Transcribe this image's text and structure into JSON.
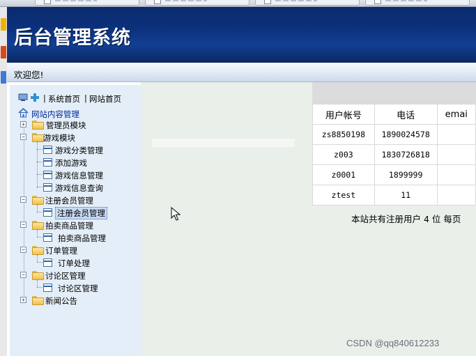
{
  "header": {
    "title": "后台管理系统"
  },
  "welcome": {
    "text": "欢迎您!"
  },
  "sidebar": {
    "top_links": [
      "系统首页",
      "网站首页"
    ],
    "separator": "|",
    "tree_root": "网站内容管理",
    "groups": [
      {
        "label": "管理员模块",
        "expanded": false,
        "children": []
      },
      {
        "label": "游戏模块",
        "expanded": true,
        "children": [
          "游戏分类管理",
          "添加游戏",
          "游戏信息管理",
          "游戏信息查询"
        ]
      },
      {
        "label": "注册会员管理",
        "expanded": true,
        "children": [
          "注册会员管理"
        ]
      },
      {
        "label": "拍卖商品管理",
        "expanded": true,
        "children": [
          "拍卖商品管理"
        ]
      },
      {
        "label": "订单管理",
        "expanded": true,
        "children": [
          "订单处理"
        ]
      },
      {
        "label": "讨论区管理",
        "expanded": true,
        "children": [
          "讨论区管理"
        ]
      },
      {
        "label": "新闻公告",
        "expanded": false,
        "children": []
      }
    ],
    "selected": "注册会员管理"
  },
  "table": {
    "headers": [
      "用户帐号",
      "电话",
      "emai"
    ],
    "rows": [
      [
        "zs8850198",
        "1890024578",
        ""
      ],
      [
        "z003",
        "1830726818",
        ""
      ],
      [
        "z0001",
        "1899999",
        ""
      ],
      [
        "ztest",
        "11",
        ""
      ]
    ]
  },
  "summary": "本站共有注册用户 4 位 每页",
  "watermark": "CSDN @qq840612233",
  "colors": {
    "header_bg": "#0b2f7a",
    "sidebar_bg": "#e4eef8",
    "content_bg": "#e9efe9"
  }
}
